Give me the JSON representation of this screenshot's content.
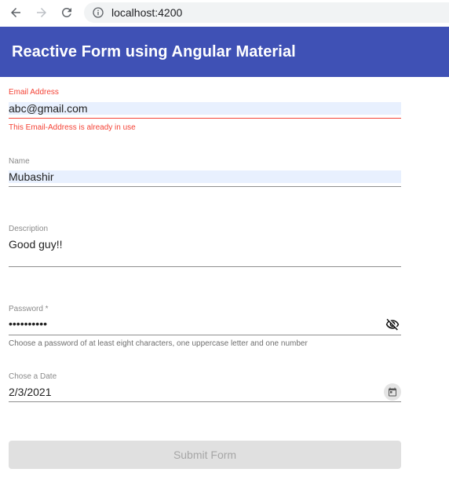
{
  "browser": {
    "url": "localhost:4200"
  },
  "app": {
    "title": "Reactive Form using Angular Material",
    "toolbar_color": "#3f51b5"
  },
  "form": {
    "email": {
      "label": "Email Address",
      "value": "abc@gmail.com",
      "error": "This Email-Address is already in use"
    },
    "name": {
      "label": "Name",
      "value": "Mubashir"
    },
    "description": {
      "label": "Description",
      "value": "Good guy!!"
    },
    "password": {
      "label": "Password *",
      "value": "••••••••••",
      "hint": "Choose a password of at least eight characters, one uppercase letter and one number",
      "icon": "visibility-off-icon"
    },
    "date": {
      "label": "Chose a Date",
      "value": "2/3/2021",
      "icon": "calendar-icon"
    },
    "submit_label": "Submit Form"
  },
  "colors": {
    "error": "#f44336",
    "primary": "#3f51b5",
    "disabled_button": "#e0e0e0"
  }
}
